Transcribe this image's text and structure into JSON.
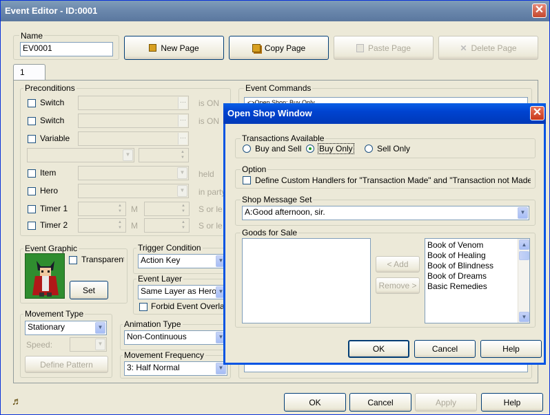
{
  "window": {
    "title": "Event Editor - ID:0001",
    "close_glyph": "✕"
  },
  "name": {
    "label": "Name",
    "value": "EV0001"
  },
  "page_buttons": {
    "new": "New Page",
    "copy": "Copy Page",
    "paste": "Paste Page",
    "delete": "Delete Page"
  },
  "tabs": [
    "1"
  ],
  "preconditions": {
    "title": "Preconditions",
    "switch1": "Switch",
    "switch2": "Switch",
    "variable": "Variable",
    "item": "Item",
    "hero": "Hero",
    "timer1": "Timer 1",
    "timer2": "Timer 2",
    "is_on1": "is ON",
    "is_on2": "is ON",
    "held": "held",
    "in_party": "in party",
    "m1": "M",
    "m2": "M",
    "s1": "S or le",
    "s2": "S or le"
  },
  "event_graphic": {
    "title": "Event Graphic",
    "transparent": "Transparent",
    "set": "Set"
  },
  "trigger": {
    "title": "Trigger Condition",
    "value": "Action Key"
  },
  "layer": {
    "title": "Event Layer",
    "value": "Same Layer as Hero",
    "forbid": "Forbid Event Overlap"
  },
  "movement_type": {
    "title": "Movement Type",
    "value": "Stationary",
    "speed": "Speed:",
    "define": "Define Pattern"
  },
  "animation": {
    "title": "Animation Type",
    "value": "Non-Continuous"
  },
  "frequency": {
    "title": "Movement Frequency",
    "value": "3: Half Normal"
  },
  "commands": {
    "title": "Event Commands",
    "first": "<>Open Shop: Buy Only"
  },
  "bottom": {
    "ok": "OK",
    "cancel": "Cancel",
    "apply": "Apply",
    "help": "Help"
  },
  "dialog": {
    "title": "Open Shop Window",
    "transactions": {
      "title": "Transactions Available",
      "options": [
        "Buy and Sell",
        "Buy Only",
        "Sell Only"
      ],
      "selected": "Buy Only"
    },
    "option": {
      "title": "Option",
      "label": "Define Custom Handlers for \"Transaction Made\" and \"Transaction not Made\""
    },
    "message": {
      "title": "Shop Message Set",
      "value": "A:Good afternoon, sir."
    },
    "goods": {
      "title": "Goods for Sale",
      "add": "< Add",
      "remove": "Remove >",
      "items": [
        "Book of Venom",
        "Book of Healing",
        "Book of Blindness",
        "Book of Dreams",
        "Basic Remedies"
      ]
    },
    "ok": "OK",
    "cancel": "Cancel",
    "help": "Help"
  },
  "icons": {
    "close": "close-icon",
    "page": "page-icon",
    "music": "music-note-icon",
    "dropdown": "chevron-down-icon"
  }
}
